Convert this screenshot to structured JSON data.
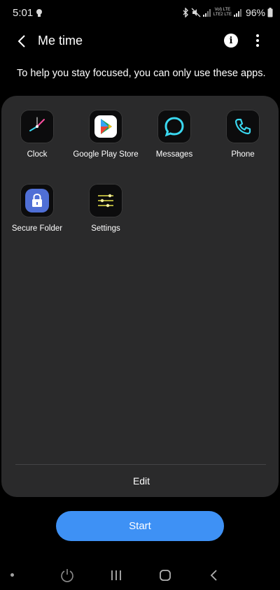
{
  "status_bar": {
    "time": "5:01",
    "network_top": "Vol) LTE",
    "network_bottom": "LTE2 LTE",
    "battery": "96%"
  },
  "app_bar": {
    "title": "Me time"
  },
  "description": "To help you stay focused, you can only use these apps.",
  "apps": [
    {
      "label": "Clock",
      "icon": "clock-icon"
    },
    {
      "label": "Google Play Store",
      "icon": "play-store-icon"
    },
    {
      "label": "Messages",
      "icon": "messages-icon"
    },
    {
      "label": "Phone",
      "icon": "phone-icon"
    },
    {
      "label": "Secure Folder",
      "icon": "secure-folder-icon"
    },
    {
      "label": "Settings",
      "icon": "settings-icon"
    }
  ],
  "edit_label": "Edit",
  "start_label": "Start",
  "colors": {
    "background": "#000000",
    "panel": "#2a2a2b",
    "accent": "#3e91f5",
    "neon_cyan": "#3ad8f0",
    "neon_yellow": "#e6e24a",
    "secure_folder_blue": "#4f6fd6"
  }
}
